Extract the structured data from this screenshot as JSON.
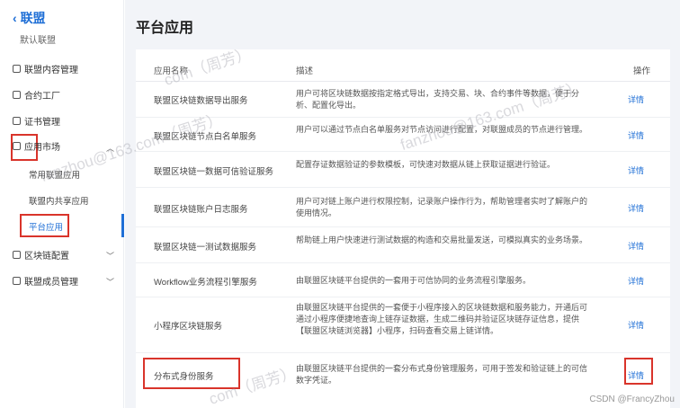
{
  "sidebar": {
    "back_label": "联盟",
    "subtitle": "默认联盟",
    "items": [
      {
        "label": "联盟内容管理"
      },
      {
        "label": "合约工厂"
      },
      {
        "label": "证书管理"
      },
      {
        "label": "应用市场"
      },
      {
        "label": "区块链配置"
      },
      {
        "label": "联盟成员管理"
      }
    ],
    "children": [
      {
        "label": "常用联盟应用"
      },
      {
        "label": "联盟内共享应用"
      },
      {
        "label": "平台应用"
      }
    ]
  },
  "main": {
    "title": "平台应用",
    "table": {
      "headers": {
        "name": "应用名称",
        "desc": "描述",
        "op": "操作"
      },
      "rows": [
        {
          "name": "联盟区块链数据导出服务",
          "desc": "用户可将区块链数据按指定格式导出，支持交易、块、合约事件等数据，便于分析、配置化导出。",
          "op": "详情"
        },
        {
          "name": "联盟区块链节点白名单服务",
          "desc": "用户可以通过节点白名单服务对节点访问进行配置，对联盟成员的节点进行管理。",
          "op": "详情"
        },
        {
          "name": "联盟区块链一数据可信验证服务",
          "desc": "配置存证数据验证的参数模板，可快速对数据从链上获取证据进行验证。",
          "op": "详情"
        },
        {
          "name": "联盟区块链账户日志服务",
          "desc": "用户可对链上账户进行权限控制，记录账户操作行为，帮助管理者实时了解账户的使用情况。",
          "op": "详情"
        },
        {
          "name": "联盟区块链一测试数据服务",
          "desc": "帮助链上用户快速进行测试数据的构造和交易批量发送，可模拟真实的业务场景。",
          "op": "详情"
        },
        {
          "name": "Workflow业务流程引擎服务",
          "desc": "由联盟区块链平台提供的一套用于可信协同的业务流程引擎服务。",
          "op": "详情"
        },
        {
          "name": "小程序区块链服务",
          "desc": "由联盟区块链平台提供的一套便于小程序接入的区块链数据和服务能力，开通后可通过小程序便捷地查询上链存证数据，生成二维码并验证区块链存证信息，提供【联盟区块链浏览器】小程序，扫码查看交易上链详情。",
          "op": "详情"
        },
        {
          "name": "分布式身份服务",
          "desc": "由联盟区块链平台提供的一套分布式身份管理服务，可用于签发和验证链上的可信数字凭证。",
          "op": "详情"
        }
      ]
    }
  },
  "watermarks": [
    "fanzhou@163.com（周芳）",
    "fanzhou@163.com（周芳）",
    "com（周芳）",
    "com（周芳）"
  ],
  "credit": "CSDN @FrancyZhou",
  "colors": {
    "accent": "#1f6fd6",
    "highlight": "#d9342b",
    "bg": "#f2f4f8"
  }
}
